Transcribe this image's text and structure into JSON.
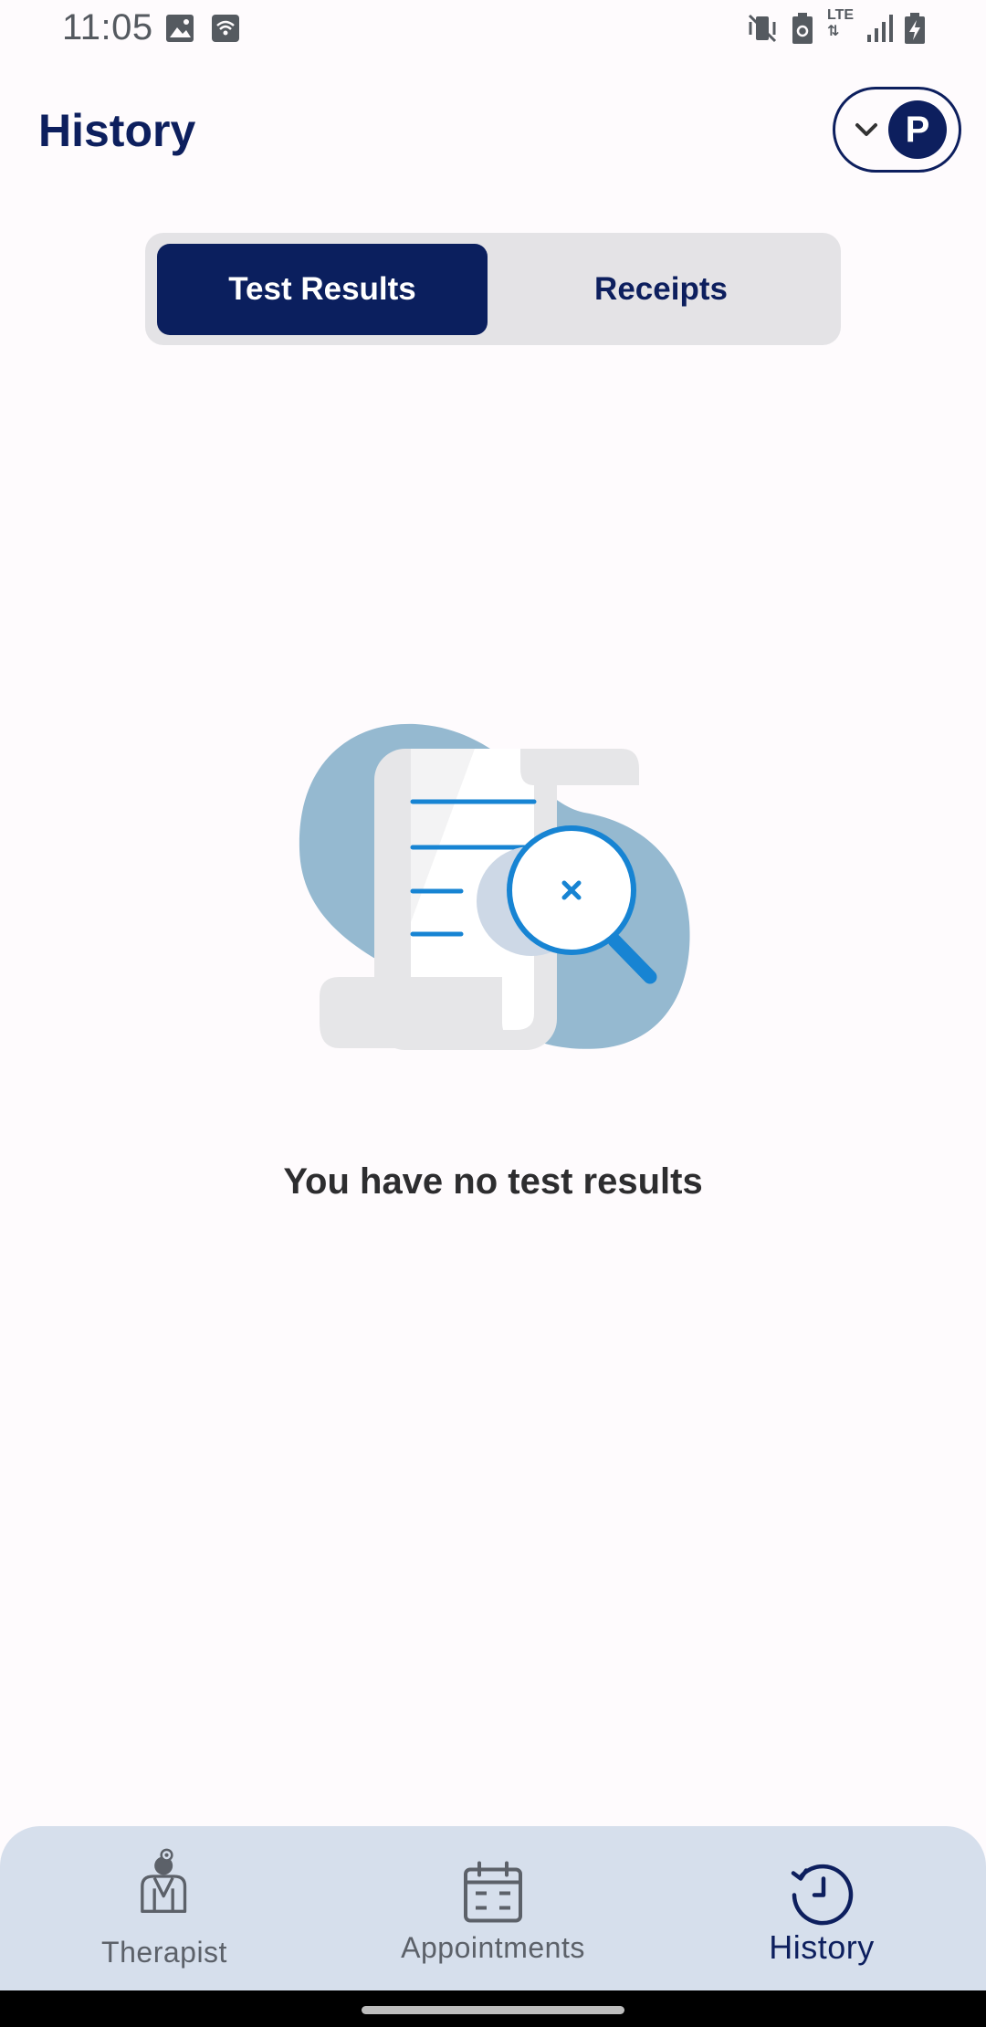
{
  "status_bar": {
    "time": "11:05",
    "icons": [
      "image-icon",
      "wifi-calling-icon",
      "mute-vibrate-icon",
      "battery-saver-icon",
      "lte-icon",
      "signal-icon",
      "battery-charging-icon"
    ],
    "network_label": "LTE"
  },
  "header": {
    "title": "History",
    "profile_initial": "P"
  },
  "tabs": [
    {
      "label": "Test Results",
      "active": true
    },
    {
      "label": "Receipts",
      "active": false
    }
  ],
  "empty_state": {
    "illustration": "document-search-icon",
    "message": "You have no test results"
  },
  "bottom_nav": {
    "items": [
      {
        "label": "Therapist",
        "icon": "therapist-icon",
        "active": false
      },
      {
        "label": "Appointments",
        "icon": "calendar-icon",
        "active": false
      },
      {
        "label": "History",
        "icon": "history-clock-icon",
        "active": true
      }
    ]
  },
  "colors": {
    "primary": "#0d1f5e",
    "background": "#fefbfd",
    "segment_bg": "#e4e3e6",
    "nav_bg": "#d6dfec",
    "illustration_blob": "#95b9d0",
    "illustration_accent": "#1784d3"
  }
}
